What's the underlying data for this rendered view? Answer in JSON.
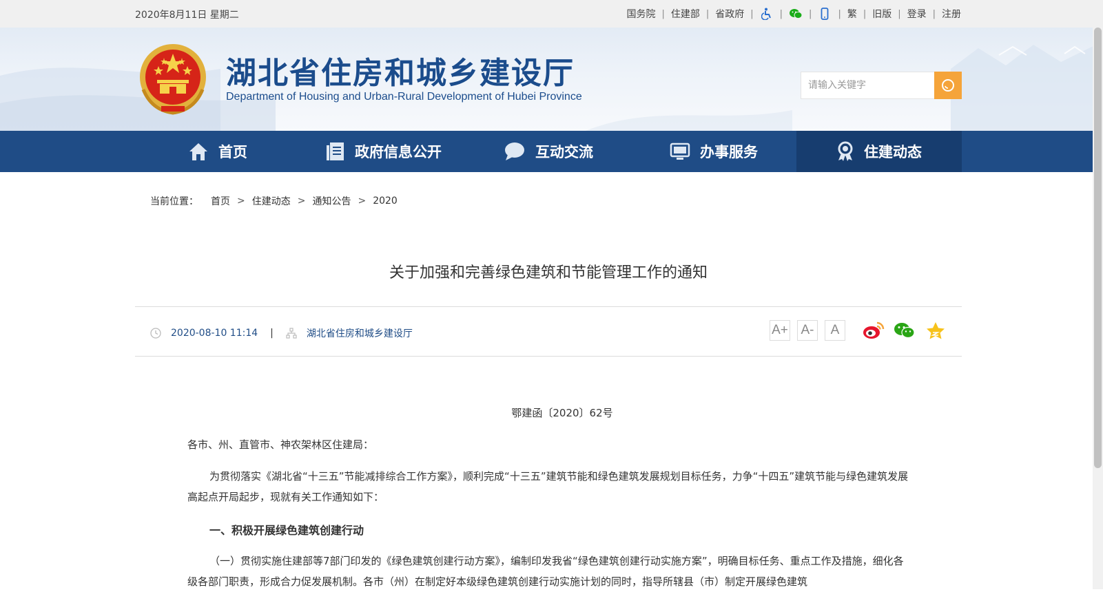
{
  "topbar": {
    "date": "2020年8月11日 星期二",
    "links": [
      "国务院",
      "住建部",
      "省政府"
    ],
    "icons": [
      "accessibility-icon",
      "wechat-icon",
      "mobile-icon"
    ],
    "tail_links": [
      "繁",
      "旧版",
      "登录",
      "注册"
    ],
    "separator": "|"
  },
  "header": {
    "title": "湖北省住房和城乡建设厅",
    "subtitle": "Department of Housing and Urban-Rural Development of Hubei Province",
    "search_placeholder": "请输入关键字"
  },
  "nav": {
    "items": [
      {
        "label": "首页",
        "icon": "home-icon"
      },
      {
        "label": "政府信息公开",
        "icon": "document-icon"
      },
      {
        "label": "互动交流",
        "icon": "chat-bubble-icon"
      },
      {
        "label": "办事服务",
        "icon": "monitor-icon"
      },
      {
        "label": "住建动态",
        "icon": "badge-icon",
        "active": true
      }
    ],
    "colors": {
      "bar": "#1f4c86",
      "active": "#173d6f"
    }
  },
  "breadcrumb": {
    "label": "当前位置：",
    "items": [
      "首页",
      "住建动态",
      "通知公告",
      "2020"
    ],
    "separator": ">"
  },
  "article": {
    "title": "关于加强和完善绿色建筑和节能管理工作的通知",
    "datetime": "2020-08-10 11:14",
    "meta_separator": "|",
    "source": "湖北省住房和城乡建设厅",
    "font_buttons": [
      "A+",
      "A-",
      "A"
    ],
    "share_icons": [
      "weibo-icon",
      "wechat-share-icon",
      "favorite-star-icon"
    ],
    "doc_number": "鄂建函〔2020〕62号",
    "salutation": "各市、州、直管市、神农架林区住建局：",
    "intro": "为贯彻落实《湖北省“十三五”节能减排综合工作方案》，顺利完成“十三五”建筑节能和绿色建筑发展规划目标任务，力争“十四五”建筑节能与绿色建筑发展高起点开局起步，现就有关工作通知如下：",
    "section1_heading": "一、积极开展绿色建筑创建行动",
    "section1_para": "（一）贯彻实施住建部等7部门印发的《绿色建筑创建行动方案》，编制印发我省“绿色建筑创建行动实施方案”，明确目标任务、重点工作及措施，细化各级各部门职责，形成合力促发展机制。各市（州）在制定好本级绿色建筑创建行动实施计划的同时，指导所辖县（市）制定开展绿色建筑"
  },
  "colors": {
    "accent": "#f5a43a",
    "brand_blue": "#1b4c8c"
  }
}
